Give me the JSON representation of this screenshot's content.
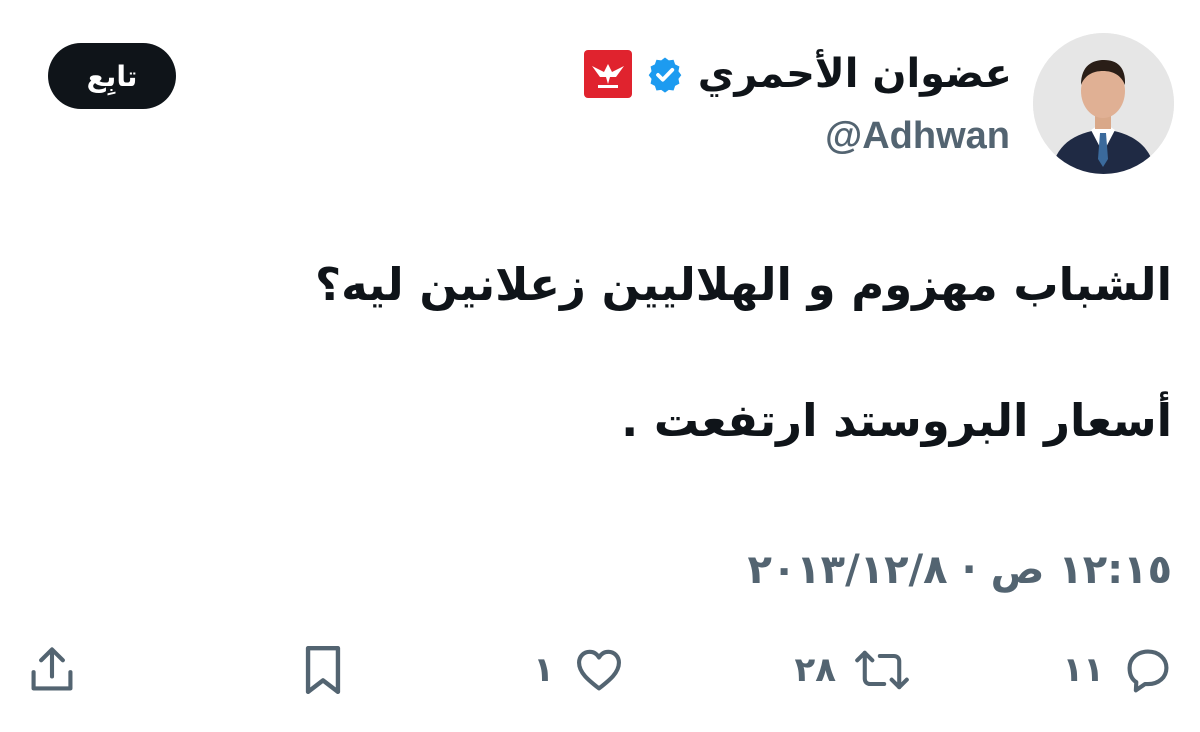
{
  "author": {
    "display_name": "عضوان الأحمري",
    "handle": "@Adhwan"
  },
  "follow_button": {
    "label": "تابِع"
  },
  "tweet": {
    "lines": [
      "الشباب مهزوم و الهلاليين زعلانين ليه؟",
      "أسعار البروستد ارتفعت ."
    ],
    "timestamp": "١٢:١٥ ص · ٢٠١٣/١٢/٨"
  },
  "actions": {
    "replies": "١١",
    "retweets": "٢٨",
    "likes": "١"
  },
  "icons": {
    "verified": "verified-icon",
    "brand_badge": "bird-logo-badge-icon",
    "reply": "reply-icon",
    "retweet": "retweet-icon",
    "like": "heart-icon",
    "bookmark": "bookmark-icon",
    "share": "share-icon"
  },
  "colors": {
    "verified_blue": "#1d9bf0",
    "badge_red": "#e0232e",
    "muted": "#536471",
    "text": "#0f1419",
    "follow_bg": "#0f1419"
  }
}
